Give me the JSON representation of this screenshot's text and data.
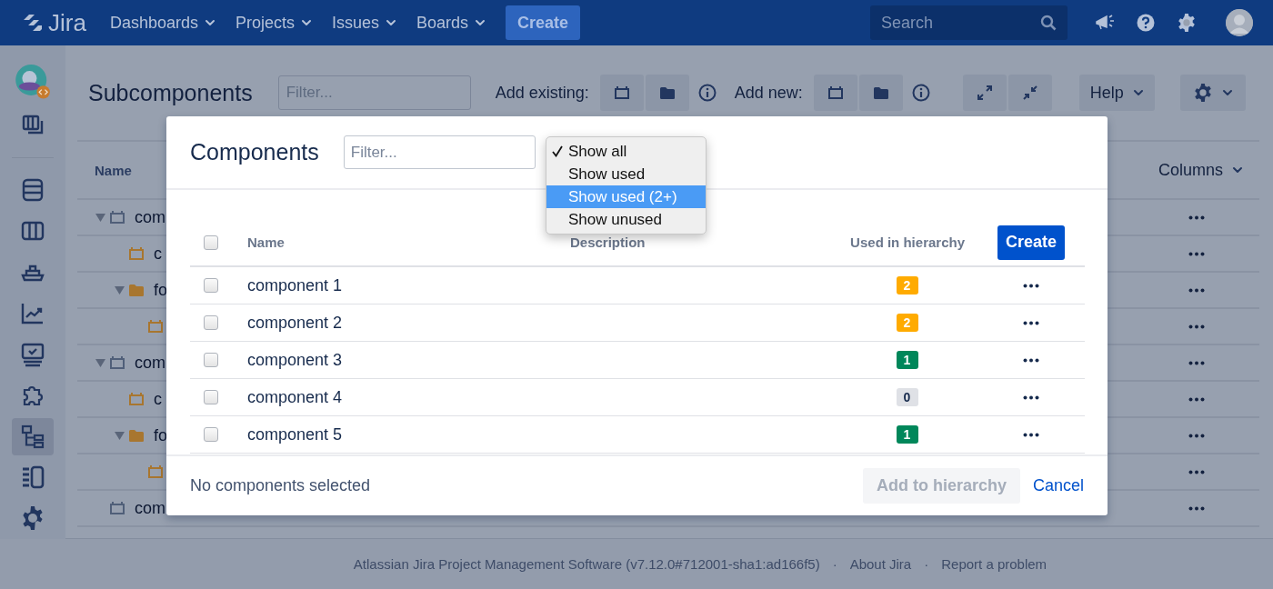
{
  "topbar": {
    "logo": "Jira",
    "nav": [
      {
        "label": "Dashboards"
      },
      {
        "label": "Projects"
      },
      {
        "label": "Issues"
      },
      {
        "label": "Boards"
      }
    ],
    "create": "Create",
    "search": {
      "placeholder": "Search"
    }
  },
  "sidebar": {
    "items": [
      {
        "kind": "board",
        "selected": false
      },
      {
        "kind": "divider"
      },
      {
        "kind": "stack",
        "selected": false
      },
      {
        "kind": "columns",
        "selected": false
      },
      {
        "kind": "ship",
        "selected": false
      },
      {
        "kind": "chart",
        "selected": false
      },
      {
        "kind": "monitor",
        "selected": false
      },
      {
        "kind": "puzzle",
        "selected": false
      },
      {
        "kind": "tree",
        "selected": true
      },
      {
        "kind": "list",
        "selected": false
      },
      {
        "kind": "gear",
        "selected": false
      }
    ]
  },
  "page": {
    "title": "Subcomponents",
    "filter": {
      "placeholder": "Filter..."
    },
    "add_existing_label": "Add existing:",
    "add_new_label": "Add new:",
    "help": "Help"
  },
  "tree": {
    "header": "Name",
    "columns_button": "Columns",
    "rows": [
      {
        "label": "com",
        "kind": "component",
        "color": "#505f79",
        "expanded": true,
        "children": [
          {
            "label": "c",
            "kind": "component",
            "color": "#a8762f"
          },
          {
            "label": "fo",
            "kind": "folder",
            "color": "#a8762f",
            "expanded": true,
            "children": [
              {
                "kind": "component",
                "color": "#a8762f"
              }
            ]
          }
        ]
      },
      {
        "label": "com",
        "kind": "component",
        "color": "#505f79",
        "expanded": true,
        "children": [
          {
            "label": "c",
            "kind": "component",
            "color": "#a8762f"
          },
          {
            "label": "fo",
            "kind": "folder",
            "color": "#a8762f",
            "expanded": true,
            "children": [
              {
                "kind": "component",
                "color": "#a8762f"
              }
            ]
          }
        ]
      },
      {
        "label": "com",
        "kind": "component",
        "color": "#505f79"
      }
    ]
  },
  "modal": {
    "title": "Components",
    "filter": {
      "placeholder": "Filter..."
    },
    "dropdown": {
      "options": [
        {
          "label": "Show all",
          "selected": true,
          "highlighted": false
        },
        {
          "label": "Show used",
          "selected": false,
          "highlighted": false
        },
        {
          "label": "Show used (2+)",
          "selected": false,
          "highlighted": true
        },
        {
          "label": "Show unused",
          "selected": false,
          "highlighted": false
        }
      ]
    },
    "table": {
      "header_checked": false,
      "columns": [
        "Name",
        "Description",
        "Used in hierarchy"
      ],
      "create": "Create",
      "rows": [
        {
          "name": "component 1",
          "checked": false,
          "count": "2",
          "color": "#ffab00"
        },
        {
          "name": "component 2",
          "checked": false,
          "count": "2",
          "color": "#ffab00"
        },
        {
          "name": "component 3",
          "checked": false,
          "count": "1",
          "color": "#00875a"
        },
        {
          "name": "component 4",
          "checked": false,
          "count": "0",
          "color": "#dfe1e6"
        },
        {
          "name": "component 5",
          "checked": false,
          "count": "1",
          "color": "#00875a"
        }
      ]
    },
    "status": "No components selected",
    "add_button": {
      "label": "Add to hierarchy",
      "disabled": true
    },
    "cancel": "Cancel"
  },
  "footer": {
    "text": "Atlassian Jira Project Management Software (v7.12.0#712001-sha1:ad166f5)",
    "links": [
      {
        "separator": "·",
        "label": "About Jira"
      },
      {
        "separator": "·",
        "label": "Report a problem"
      }
    ]
  }
}
